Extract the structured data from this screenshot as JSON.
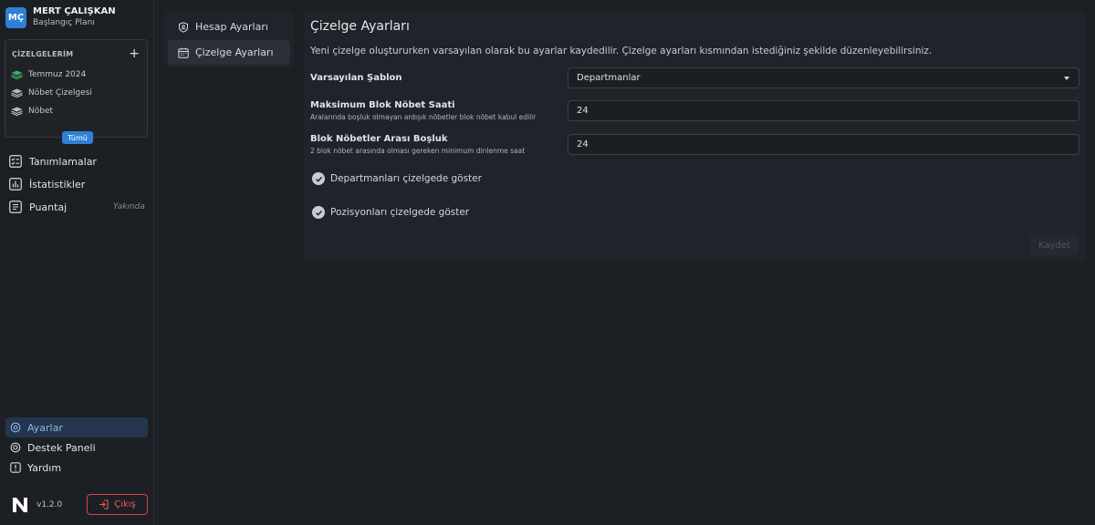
{
  "user": {
    "initials": "MÇ",
    "name": "MERT ÇALIŞKAN",
    "plan": "Başlangıç Planı"
  },
  "charts": {
    "title": "ÇİZELGELERİM",
    "add": "+",
    "items": [
      {
        "label": "Temmuz 2024",
        "icon": "layers-icon",
        "color": "#3fae6a"
      },
      {
        "label": "Nöbet Çizelgesi",
        "icon": "layers-icon",
        "color": "#b8bcc2"
      },
      {
        "label": "Nöbet",
        "icon": "layers-icon",
        "color": "#b8bcc2"
      }
    ],
    "all_label": "Tümü"
  },
  "nav": {
    "items": [
      {
        "label": "Tanımlamalar",
        "icon": "checklist-icon"
      },
      {
        "label": "İstatistikler",
        "icon": "bar-chart-icon"
      },
      {
        "label": "Puantaj",
        "icon": "document-icon",
        "badge": "Yakında"
      }
    ]
  },
  "bottom_nav": {
    "items": [
      {
        "label": "Ayarlar",
        "icon": "gear-icon",
        "active": true
      },
      {
        "label": "Destek Paneli",
        "icon": "support-icon"
      },
      {
        "label": "Yardım",
        "icon": "help-icon"
      }
    ]
  },
  "footer": {
    "version": "v1.2.0",
    "logout_label": "Çıkış"
  },
  "submenu": {
    "items": [
      {
        "label": "Hesap Ayarları",
        "icon": "user-shield-icon",
        "active": false
      },
      {
        "label": "Çizelge Ayarları",
        "icon": "calendar-icon",
        "active": true
      }
    ]
  },
  "panel": {
    "title": "Çizelge Ayarları",
    "description": "Yeni çizelge oluştururken varsayılan olarak bu ayarlar kaydedilir. Çizelge ayarları kısmından istediğiniz şekilde düzenleyebilirsiniz.",
    "template": {
      "label": "Varsayılan Şablon",
      "value": "Departmanlar"
    },
    "max_block": {
      "label": "Maksimum Blok Nöbet Saati",
      "sub": "Aralarında boşluk olmayan ardışık nöbetler blok nöbet kabul edilir",
      "value": "24"
    },
    "block_gap": {
      "label": "Blok Nöbetler Arası Boşluk",
      "sub": "2 blok nöbet arasında olması gereken minimum dinlenme saat",
      "value": "24"
    },
    "checkboxes": [
      {
        "label": "Departmanları çizelgede göster",
        "checked": true
      },
      {
        "label": "Pozisyonları çizelgede göster",
        "checked": true
      }
    ],
    "save_label": "Kaydet"
  },
  "colors": {
    "accent": "#2f80d6",
    "danger": "#d9444a",
    "background": "#1c1f24",
    "panel": "#20242a"
  }
}
